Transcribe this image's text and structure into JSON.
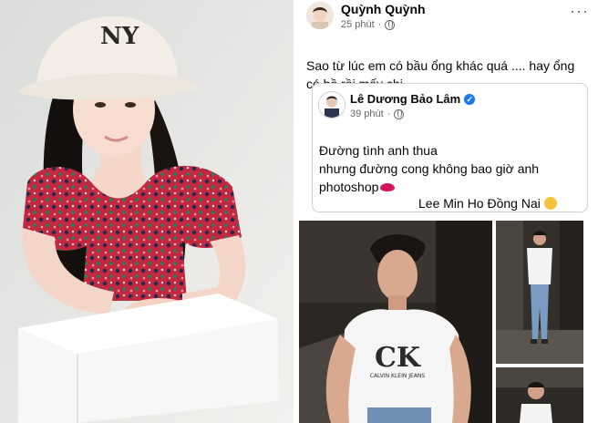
{
  "post": {
    "author": "Quỳnh Quỳnh",
    "time": "25 phút",
    "text": "Sao từ lúc em có bầu ổng khác quá .... hay ổng có bồ rồi mấy chị",
    "more_label": "···"
  },
  "shared": {
    "author": "Lê Dương Bảo Lâm",
    "time": "39 phút",
    "lines": [
      "Đường tình anh thua",
      "nhưng đường cong không bao giờ anh",
      "photoshop"
    ],
    "signature": "Lee Min Ho Đồng Nai"
  },
  "icons": {
    "privacy": "globe-icon",
    "verified": "verified-badge-icon",
    "more": "more-options-icon",
    "kiss": "kiss-mark-emoji",
    "wink": "winking-face-emoji"
  },
  "photo_labels": {
    "hat_logo": "NY",
    "shirt_logo": "CK",
    "shirt_text": "CALVIN KLEIN JEANS"
  },
  "colors": {
    "link_blue": "#1877f2",
    "text_primary": "#050505",
    "text_secondary": "#65676b",
    "card_border": "#ced0d4"
  }
}
